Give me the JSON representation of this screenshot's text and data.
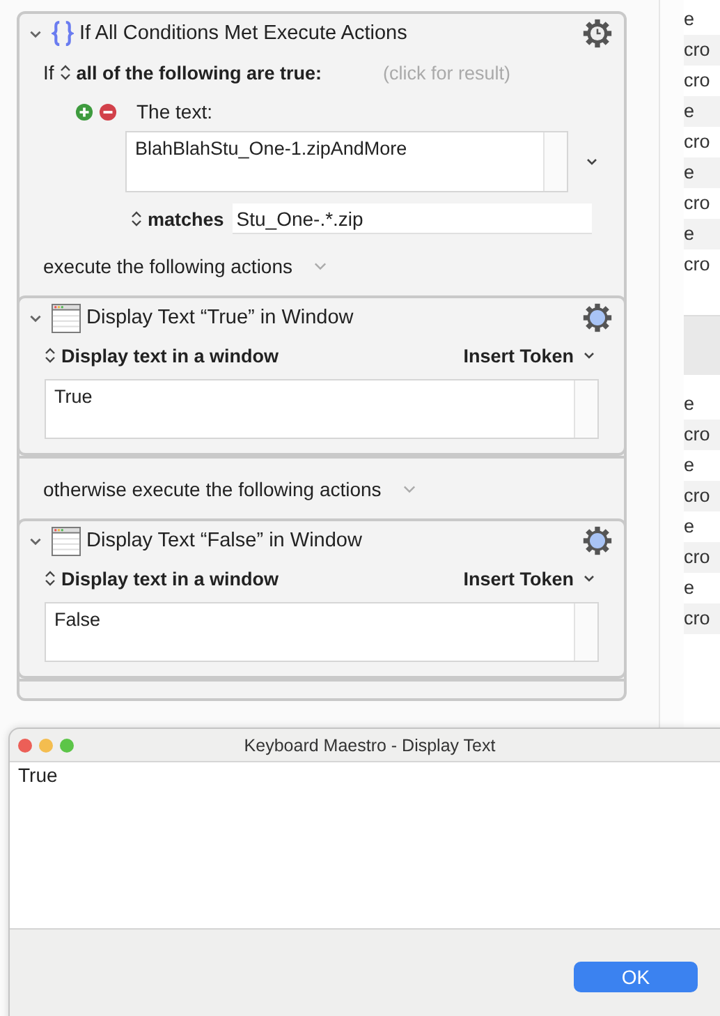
{
  "if_action": {
    "title": "If All Conditions Met Execute Actions",
    "expanded": true,
    "if_label": "If",
    "mode": "all of the following are true:",
    "result_hint": "(click for result)",
    "conditions": [
      {
        "label": "The text:",
        "value": "BlahBlahStu_One-1.zipAndMore",
        "operator": "matches",
        "pattern": "Stu_One-.*.zip"
      }
    ],
    "then_label": "execute the following actions",
    "then_actions": [
      {
        "title": "Display Text “True” in Window",
        "expanded": true,
        "mode": "Display text in a window",
        "token_menu": "Insert Token",
        "text": "True"
      }
    ],
    "else_label": "otherwise execute the following actions",
    "else_actions": [
      {
        "title": "Display Text “False” in Window",
        "expanded": true,
        "mode": "Display text in a window",
        "token_menu": "Insert Token",
        "text": "False"
      }
    ]
  },
  "background_list_top": [
    "e",
    "cro",
    "cro",
    "e",
    "cro",
    "e",
    "cro",
    "e",
    "cro"
  ],
  "background_list_bottom": [
    "e",
    "cro",
    "e",
    "cro",
    "e",
    "cro",
    "e",
    "cro"
  ],
  "dialog": {
    "title": "Keyboard Maestro - Display Text",
    "text": "True",
    "button": "OK"
  }
}
